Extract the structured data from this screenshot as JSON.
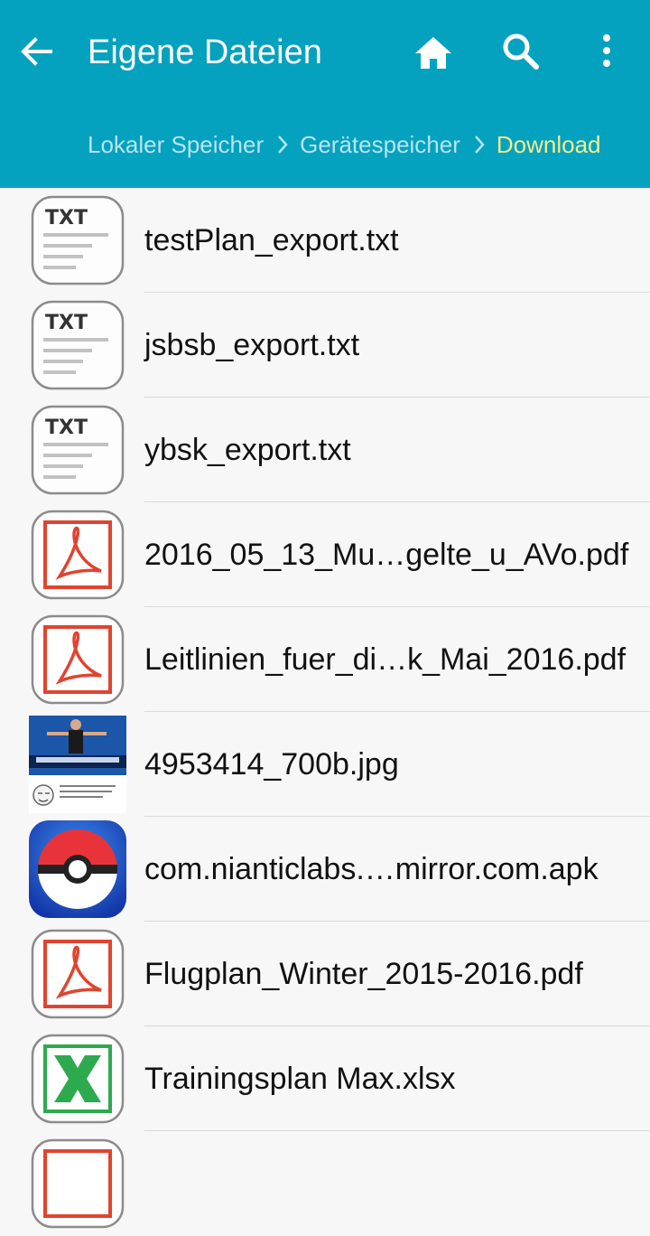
{
  "appbar": {
    "title": "Eigene Dateien",
    "back_icon": "arrow-left-icon",
    "actions": [
      "home-icon",
      "search-icon",
      "more-vert-icon"
    ],
    "background": "#04a2be"
  },
  "breadcrumb": {
    "items": [
      "Lokaler Speicher",
      "Gerätespeicher",
      "Download"
    ],
    "current_color": "#f3ec8e"
  },
  "files": [
    {
      "name": "testPlan_export.txt",
      "type": "txt",
      "icon_label": "TXT"
    },
    {
      "name": "jsbsb_export.txt",
      "type": "txt",
      "icon_label": "TXT"
    },
    {
      "name": "ybsk_export.txt",
      "type": "txt",
      "icon_label": "TXT"
    },
    {
      "name": "2016_05_13_Mu…gelte_u_AVo.pdf",
      "type": "pdf"
    },
    {
      "name": "Leitlinien_fuer_di…k_Mai_2016.pdf",
      "type": "pdf"
    },
    {
      "name": "4953414_700b.jpg",
      "type": "jpg"
    },
    {
      "name": "com.nianticlabs.…mirror.com.apk",
      "type": "apk"
    },
    {
      "name": "Flugplan_Winter_2015-2016.pdf",
      "type": "pdf"
    },
    {
      "name": "Trainingsplan Max.xlsx",
      "type": "xlsx"
    }
  ]
}
